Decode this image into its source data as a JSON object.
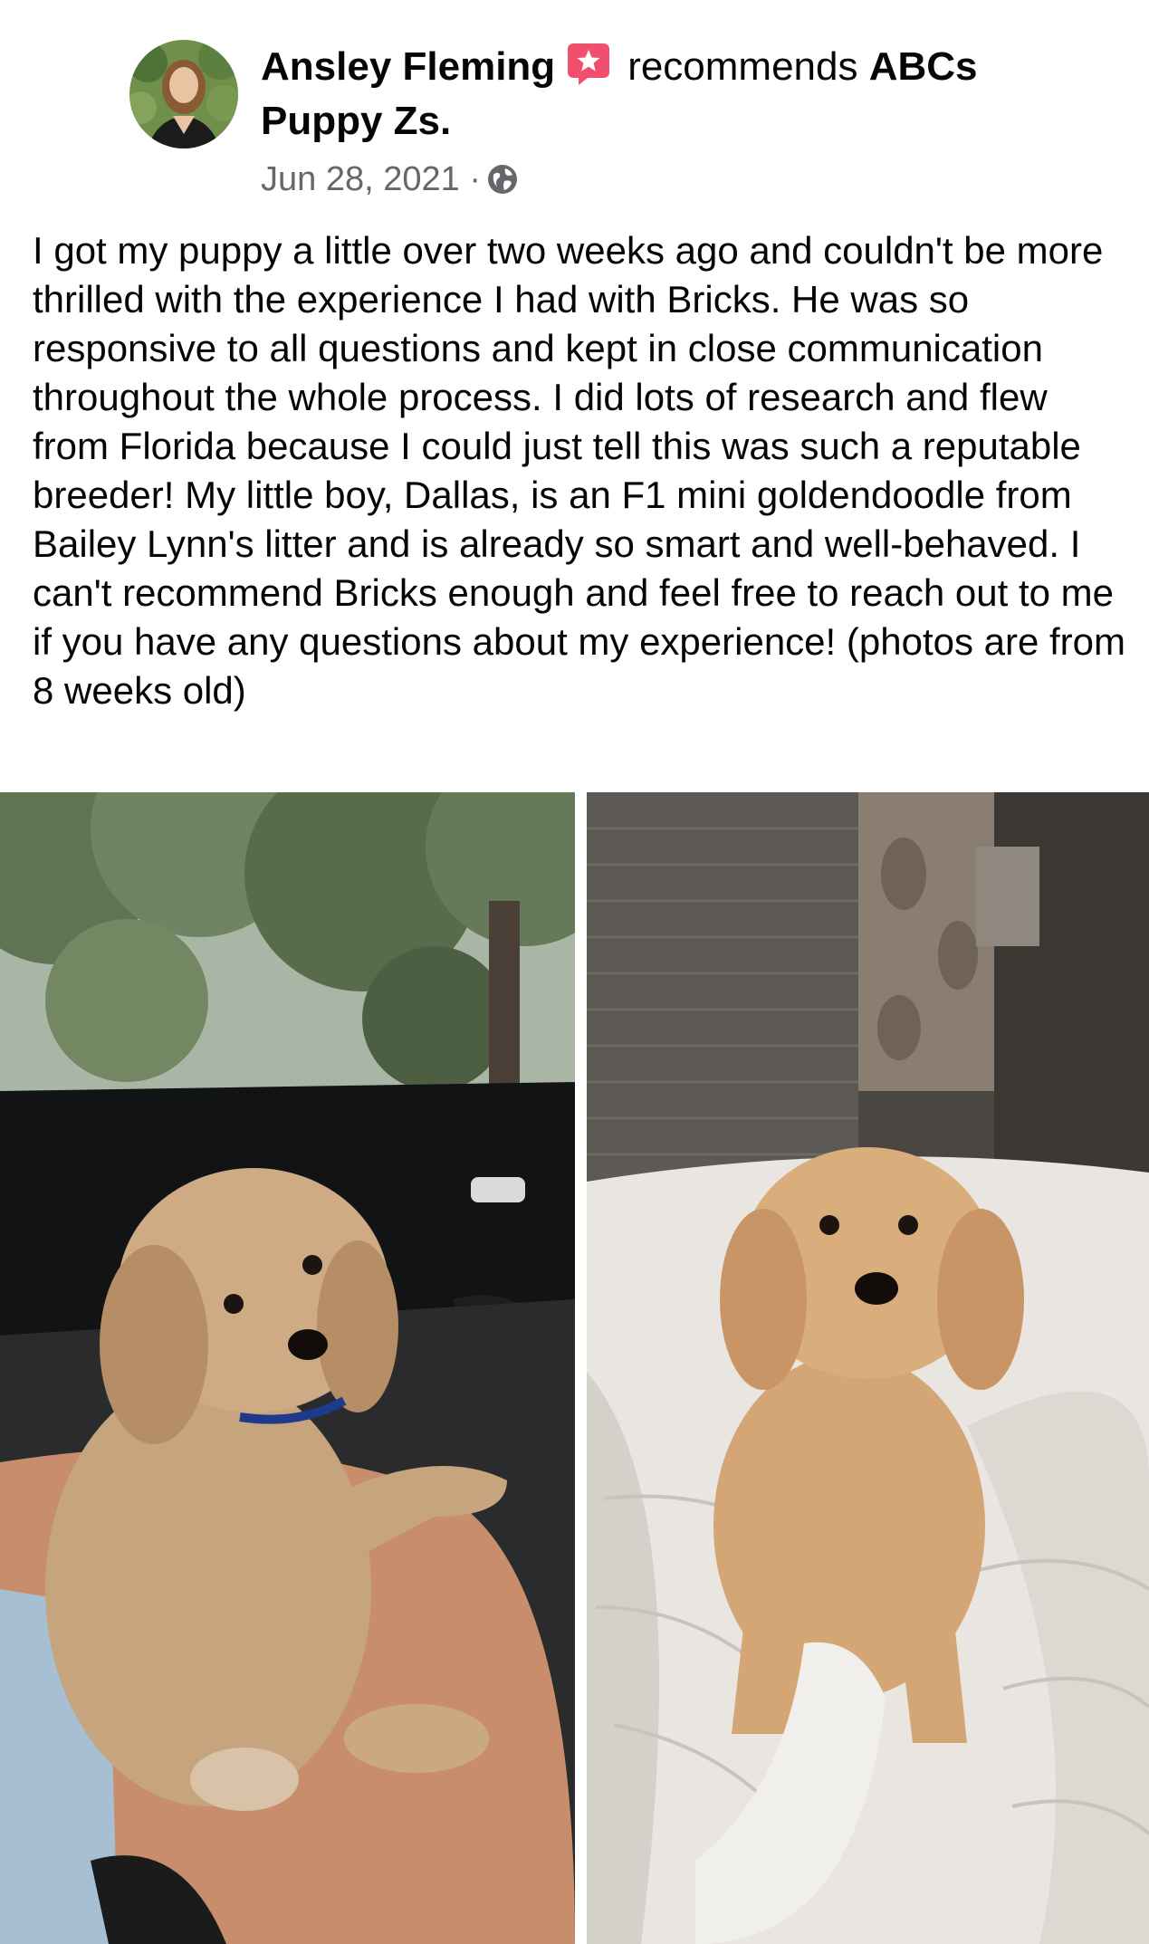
{
  "post": {
    "author": "Ansley Fleming",
    "recommends_text": "recommends",
    "page_name_line1": "ABCs",
    "page_name_line2": "Puppy Zs.",
    "date": "Jun 28, 2021",
    "separator": "·",
    "audience_icon": "globe-icon",
    "recommend_icon": "recommendation-star-icon",
    "body": "I got my puppy a little over two weeks ago and couldn't be more thrilled with the experience I had with Bricks. He was so responsive to all questions and kept in close communication throughout the whole process. I did lots of research and flew from Florida because I could just tell this was such a reputable breeder! My little boy, Dallas, is an F1 mini goldendoodle from Bailey Lynn's litter and is already so smart and well-behaved. I can't recommend Bricks enough and feel free to reach out to me if you have any questions about my experience! (photos are from 8 weeks old)"
  },
  "photos": [
    {
      "subject": "puppy-in-car-photo"
    },
    {
      "subject": "puppy-on-bed-photo"
    }
  ],
  "colors": {
    "recommend_badge": "#f0506e",
    "secondary_text": "#65676b",
    "primary_text": "#050505"
  }
}
